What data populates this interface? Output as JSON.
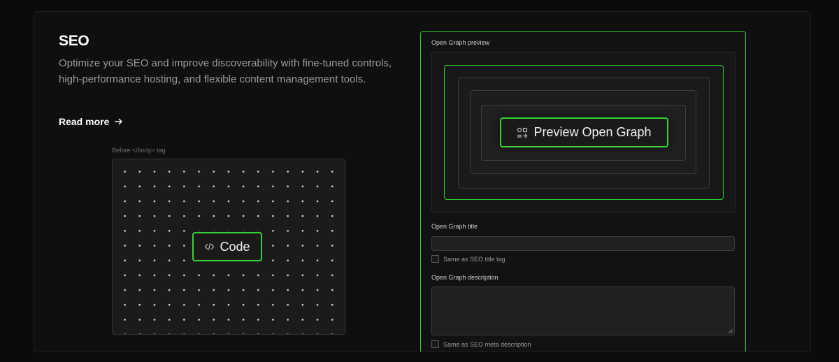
{
  "section": {
    "title": "SEO",
    "description": "Optimize your SEO and improve discoverability with fine-tuned controls, high-performance hosting, and flexible content management tools.",
    "read_more": "Read more"
  },
  "code_panel": {
    "label": "Before </body> tag",
    "button_label": "Code"
  },
  "open_graph": {
    "preview_label": "Open Graph preview",
    "preview_button_label": "Preview Open Graph",
    "title_label": "Open Graph title",
    "title_value": "",
    "title_checkbox_label": "Same as SEO title tag",
    "title_checkbox_checked": false,
    "description_label": "Open Graph description",
    "description_value": "",
    "description_checkbox_label": "Same as SEO meta description",
    "description_checkbox_checked": false
  },
  "colors": {
    "accent_green": "#35d135",
    "background": "#0b0b0b"
  },
  "icons": {
    "read_more": "arrow-right-icon",
    "code": "code-icon",
    "preview": "shapes-icon"
  }
}
